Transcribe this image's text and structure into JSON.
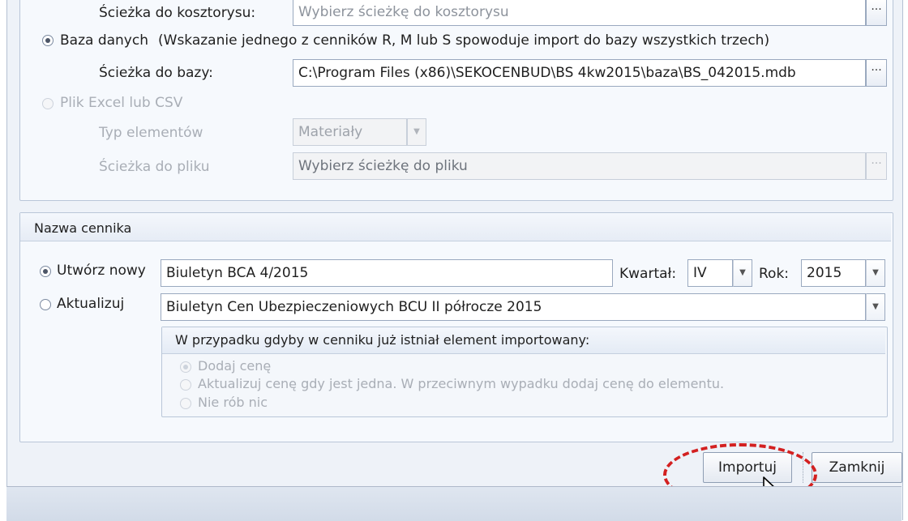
{
  "source_section": {
    "cost_estimate_path_label": "Ścieżka do kosztorysu:",
    "cost_estimate_path_placeholder": "Wybierz ścieżkę do kosztorysu",
    "database_option_label": "Baza danych",
    "database_option_note": "(Wskazanie jednego z cenników R, M lub S spowoduje import do bazy wszystkich trzech)",
    "database_path_label": "Ścieżka do bazy:",
    "database_path_value": "C:\\Program Files (x86)\\SEKOCENBUD\\BS 4kw2015\\baza\\BS_042015.mdb",
    "excel_option_label": "Plik Excel lub CSV",
    "element_type_label": "Typ elementów",
    "element_type_value": "Materiały",
    "file_path_label": "Ścieżka do pliku",
    "file_path_placeholder": "Wybierz ścieżkę do pliku",
    "browse_glyph": "···",
    "dropdown_glyph": "▼"
  },
  "price_list_section": {
    "title": "Nazwa cennika",
    "create_new_label": "Utwórz nowy",
    "create_new_value": "Biuletyn BCA 4/2015",
    "quarter_label": "Kwartał:",
    "quarter_value": "IV",
    "year_label": "Rok:",
    "year_value": "2015",
    "update_label": "Aktualizuj",
    "update_value": "Biuletyn Cen Ubezpieczeniowych BCU II półrocze 2015"
  },
  "existing_element_section": {
    "title": "W przypadku gdyby w cenniku już istniał element importowany:",
    "options": [
      "Dodaj cenę",
      "Aktualizuj cenę gdy jest jedna. W przeciwnym wypadku dodaj cenę do elementu.",
      "Nie rób nic"
    ]
  },
  "footer": {
    "import_button": "Importuj",
    "close_button": "Zamknij"
  },
  "colors": {
    "highlight": "#d32020",
    "window_bg": "#eef2f8"
  }
}
